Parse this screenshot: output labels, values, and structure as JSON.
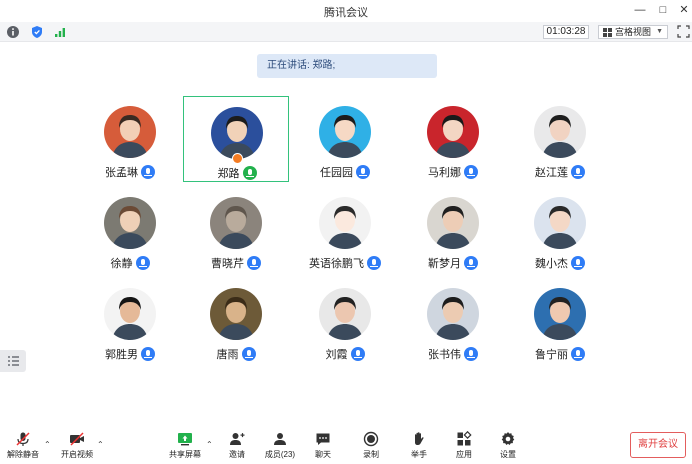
{
  "window": {
    "title": "腾讯会议"
  },
  "toolbar": {
    "timer": "01:03:28",
    "view_label": "宫格视图"
  },
  "speaking": {
    "text": "正在讲话: 郑路;"
  },
  "participants": [
    {
      "name": "张孟琳",
      "bg": "#d65c3a",
      "skin": "#f2cfb6",
      "hair": "#3a2a22"
    },
    {
      "name": "郑路",
      "bg": "#2b4f9c",
      "skin": "#f1d2b8",
      "hair": "#1c1c1c"
    },
    {
      "name": "任园园",
      "bg": "#2fb0e6",
      "skin": "#f6d9c5",
      "hair": "#1d1d1d"
    },
    {
      "name": "马利娜",
      "bg": "#c9252c",
      "skin": "#f3d6c3",
      "hair": "#1a1a1a"
    },
    {
      "name": "赵江莲",
      "bg": "#e9e9ea",
      "skin": "#f1d3c2",
      "hair": "#1e1e1e"
    },
    {
      "name": "徐静",
      "bg": "#7c7a72",
      "skin": "#efd0b7",
      "hair": "#6b4a35"
    },
    {
      "name": "曹晓芹",
      "bg": "#8b847c",
      "skin": "#b9ab9c",
      "hair": "#5f564d"
    },
    {
      "name": "英语徐鹏飞",
      "bg": "#f2f2f2",
      "skin": "#fbe9de",
      "hair": "#2b2b2b"
    },
    {
      "name": "靳梦月",
      "bg": "#d9d6d0",
      "skin": "#edcdb6",
      "hair": "#202020"
    },
    {
      "name": "魏小杰",
      "bg": "#dbe3ee",
      "skin": "#f4d8c6",
      "hair": "#2a2a2a"
    },
    {
      "name": "郭胜男",
      "bg": "#f3f3f3",
      "skin": "#e5b998",
      "hair": "#151515"
    },
    {
      "name": "唐雨",
      "bg": "#6d5a38",
      "skin": "#d9b38a",
      "hair": "#3b2c18"
    },
    {
      "name": "刘霞",
      "bg": "#e8e8e8",
      "skin": "#ecc7b0",
      "hair": "#222222"
    },
    {
      "name": "张书伟",
      "bg": "#cfd6df",
      "skin": "#eccbb2",
      "hair": "#1d1d1d"
    },
    {
      "name": "鲁宁丽",
      "bg": "#2d6fb0",
      "skin": "#efc9b0",
      "hair": "#222222"
    }
  ],
  "bottombar": {
    "unmute": "解除静音",
    "start_video": "开启视频",
    "share_screen": "共享屏幕",
    "invite": "邀请",
    "members": "成员(23)",
    "chat": "聊天",
    "record": "录制",
    "raise_hand": "举手",
    "apps": "应用",
    "settings": "设置",
    "leave": "离开会议"
  },
  "colors": {
    "accent": "#2f7cf6",
    "active_border": "#33c27c",
    "leave_red": "#e04040"
  }
}
